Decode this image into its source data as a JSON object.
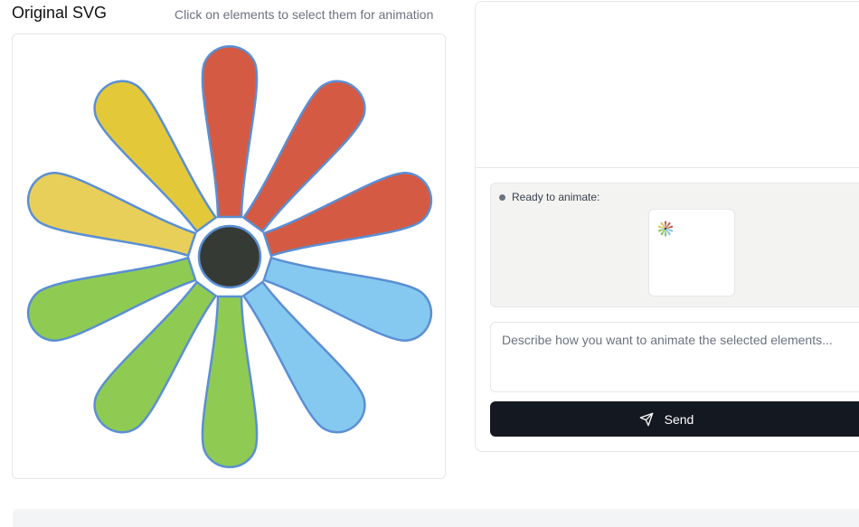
{
  "left_panel": {
    "title": "Original SVG",
    "hint": "Click on elements to select them for animation"
  },
  "flower": {
    "petals": [
      {
        "name": "petal-top",
        "color": "#d45a44"
      },
      {
        "name": "petal-top-right",
        "color": "#d45a44"
      },
      {
        "name": "petal-right-upper",
        "color": "#d45a44"
      },
      {
        "name": "petal-right-lower",
        "color": "#85c9f0"
      },
      {
        "name": "petal-bottom-right",
        "color": "#85c9f0"
      },
      {
        "name": "petal-bottom",
        "color": "#8fcb52"
      },
      {
        "name": "petal-bottom-left",
        "color": "#8fcb52"
      },
      {
        "name": "petal-left-lower",
        "color": "#8fcb52"
      },
      {
        "name": "petal-left-upper",
        "color": "#e8cf5a"
      },
      {
        "name": "petal-top-left",
        "color": "#e3c93a"
      }
    ],
    "center_color": "#363a35",
    "outline_color": "#5b8fd3"
  },
  "right_panel": {
    "status_text": "Ready to animate:",
    "prompt_placeholder": "Describe how you want to animate the selected elements...",
    "send_label": "Send"
  }
}
